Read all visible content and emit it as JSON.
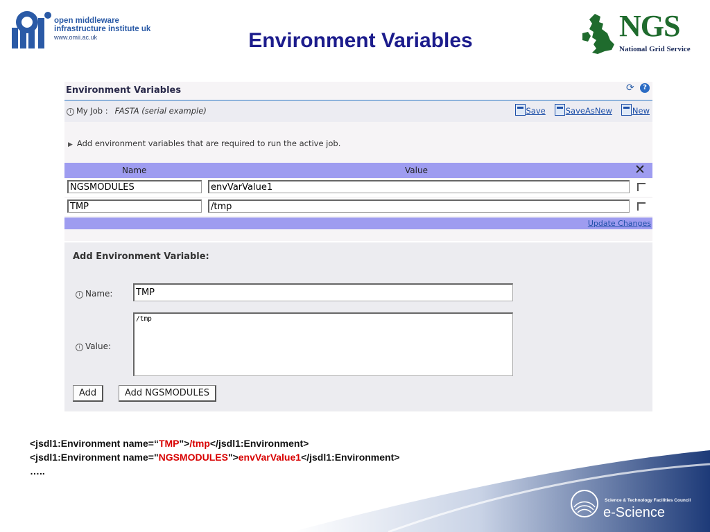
{
  "header": {
    "omii_lines": [
      "open middleware",
      "infrastructure institute uk"
    ],
    "omii_url": "www.omii.ac.uk",
    "title": "Environment Variables",
    "ngs_title": "NGS",
    "ngs_subtitle": "National Grid Service"
  },
  "panel": {
    "title": "Environment Variables",
    "job_label": "My Job :",
    "job_value": "FASTA (serial example)",
    "actions": {
      "save": "Save",
      "save_as_new": "SaveAsNew",
      "new": "New"
    },
    "hint": "Add environment variables that are required to run the active job.",
    "columns": {
      "name": "Name",
      "value": "Value"
    },
    "rows": [
      {
        "name": "NGSMODULES",
        "value": "envVarValue1"
      },
      {
        "name": "TMP",
        "value": "/tmp"
      }
    ],
    "update_link": "Update Changes"
  },
  "add_form": {
    "title": "Add Environment Variable:",
    "name_label": "Name:",
    "name_value": "TMP",
    "value_label": "Value:",
    "value_text": "/tmp",
    "add_button": "Add",
    "add_ngsmodules_button": "Add NGSMODULES"
  },
  "xml_example": {
    "line1_prefix": "<jsdl1:Environment name=“",
    "line1_name": "TMP",
    "line1_mid": "\">",
    "line1_value": "/tmp",
    "line1_suffix": "</jsdl1:Environment>",
    "line2_prefix": "<jsdl1:Environment name=\"",
    "line2_name": "NGSMODULES",
    "line2_mid": "\">",
    "line2_value": "envVarValue1",
    "line2_suffix": "</jsdl1:Environment>",
    "line3": "….."
  },
  "footer": {
    "org": "Science & Technology Facilities Council",
    "brand": "e-Science"
  },
  "colors": {
    "title_blue": "#1c1c8c",
    "grid_header": "#9e9cf0",
    "xml_red": "#d80000",
    "link_blue": "#1d4fa8"
  }
}
